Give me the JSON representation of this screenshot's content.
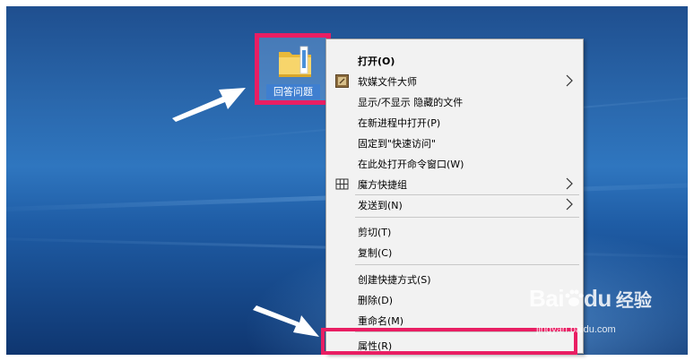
{
  "desktop": {
    "folder_label": "回答问题"
  },
  "context_menu": {
    "items": [
      {
        "label": "打开(O)"
      },
      {
        "label": "软媒文件大师"
      },
      {
        "label": "显示/不显示 隐藏的文件"
      },
      {
        "label": "在新进程中打开(P)"
      },
      {
        "label": "固定到\"快速访问\""
      },
      {
        "label": "在此处打开命令窗口(W)"
      },
      {
        "label": "魔方快捷组"
      },
      {
        "label": "发送到(N)"
      },
      {
        "label": "剪切(T)"
      },
      {
        "label": "复制(C)"
      },
      {
        "label": "创建快捷方式(S)"
      },
      {
        "label": "删除(D)"
      },
      {
        "label": "重命名(M)"
      },
      {
        "label": "属性(R)"
      }
    ]
  },
  "watermark": {
    "brand": "Bai",
    "brand_suffix": "du",
    "brand_cn": "经验",
    "url": "jingyan.baidu.com"
  },
  "colors": {
    "highlight": "#e91e63",
    "menu_bg": "#f2f2f2",
    "desktop_blue": "#2a68ad"
  }
}
